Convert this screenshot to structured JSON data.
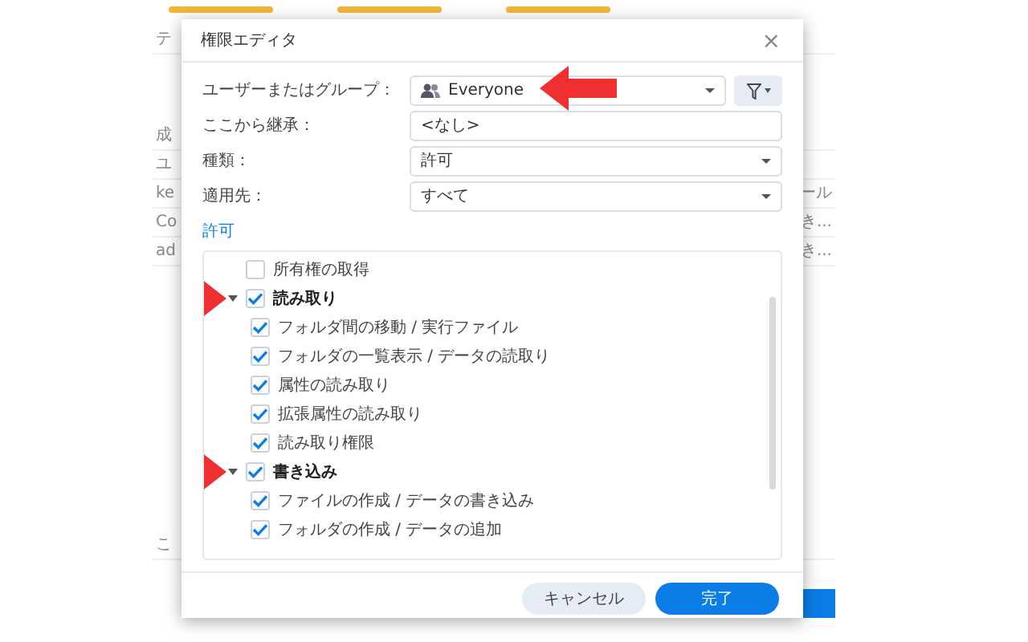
{
  "background": {
    "left_texts": [
      "テ",
      "成",
      "ユ",
      "ke",
      "Co",
      "ad",
      "こ"
    ],
    "right_texts": [
      "ール",
      "き...",
      "き..."
    ]
  },
  "dialog": {
    "title": "権限エディタ",
    "close": "×",
    "fields": [
      {
        "kind": "combo",
        "label": "ユーザーまたはグループ：",
        "value": "Everyone",
        "arrow": true
      },
      {
        "kind": "text",
        "label": "ここから継承：",
        "value": "<なし>",
        "arrow": false
      },
      {
        "kind": "select",
        "label": "種類：",
        "value": "許可",
        "arrow": false
      },
      {
        "kind": "select",
        "label": "適用先：",
        "value": "すべて",
        "arrow": false
      }
    ],
    "section_link": "許可",
    "tree": [
      {
        "label": "所有権の取得",
        "checked": false,
        "arrow": false
      },
      {
        "label": "読み取り",
        "checked": true,
        "expanded": true,
        "arrow": true,
        "children": [
          {
            "label": "フォルダ間の移動 / 実行ファイル",
            "checked": true
          },
          {
            "label": "フォルダの一覧表示 / データの読取り",
            "checked": true
          },
          {
            "label": "属性の読み取り",
            "checked": true
          },
          {
            "label": "拡張属性の読み取り",
            "checked": true
          },
          {
            "label": "読み取り権限",
            "checked": true
          }
        ]
      },
      {
        "label": "書き込み",
        "checked": true,
        "expanded": true,
        "arrow": true,
        "children": [
          {
            "label": "ファイルの作成 / データの書き込み",
            "checked": true
          },
          {
            "label": "フォルダの作成 / データの追加",
            "checked": true
          }
        ]
      }
    ],
    "buttons": [
      {
        "label": "キャンセル",
        "primary": false
      },
      {
        "label": "完了",
        "primary": true
      }
    ]
  }
}
